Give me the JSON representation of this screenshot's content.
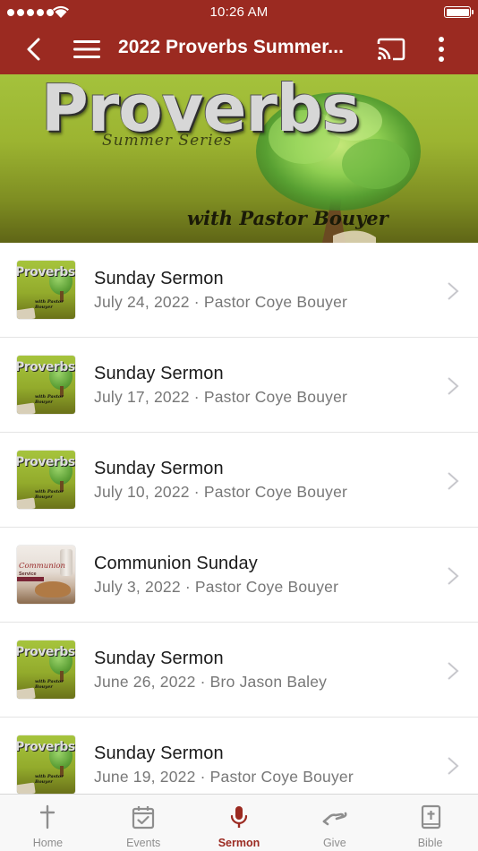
{
  "status_bar": {
    "time": "10:26 AM"
  },
  "nav": {
    "title": "2022 Proverbs Summer..."
  },
  "banner": {
    "title": "Proverbs",
    "series": "Summer Series",
    "subtitle": "with Pastor Bouyer"
  },
  "sermons": [
    {
      "title": "Sunday Sermon",
      "meta": "July 24, 2022 · Pastor Coye Bouyer",
      "thumb": "proverbs"
    },
    {
      "title": "Sunday Sermon",
      "meta": "July 17, 2022 · Pastor Coye Bouyer",
      "thumb": "proverbs"
    },
    {
      "title": "Sunday Sermon",
      "meta": "July 10, 2022 · Pastor Coye Bouyer",
      "thumb": "proverbs"
    },
    {
      "title": "Communion Sunday",
      "meta": "July 3, 2022 · Pastor Coye Bouyer",
      "thumb": "communion"
    },
    {
      "title": "Sunday Sermon",
      "meta": "June 26, 2022 · Bro Jason Baley",
      "thumb": "proverbs"
    },
    {
      "title": "Sunday Sermon",
      "meta": "June 19, 2022 · Pastor Coye Bouyer",
      "thumb": "proverbs"
    }
  ],
  "thumb_text": {
    "proverbs_title": "Proverbs",
    "proverbs_sub": "with Pastor Bouyer",
    "communion_title": "Communion",
    "communion_sub": "Service"
  },
  "tabs": [
    {
      "label": "Home",
      "icon": "cross-icon"
    },
    {
      "label": "Events",
      "icon": "calendar-check-icon"
    },
    {
      "label": "Sermon",
      "icon": "microphone-icon",
      "active": true
    },
    {
      "label": "Give",
      "icon": "giving-hand-icon"
    },
    {
      "label": "Bible",
      "icon": "bible-icon"
    }
  ],
  "colors": {
    "brand": "#9b2a21",
    "inactive_tab": "#8e8e8e",
    "meta_text": "#777777"
  }
}
